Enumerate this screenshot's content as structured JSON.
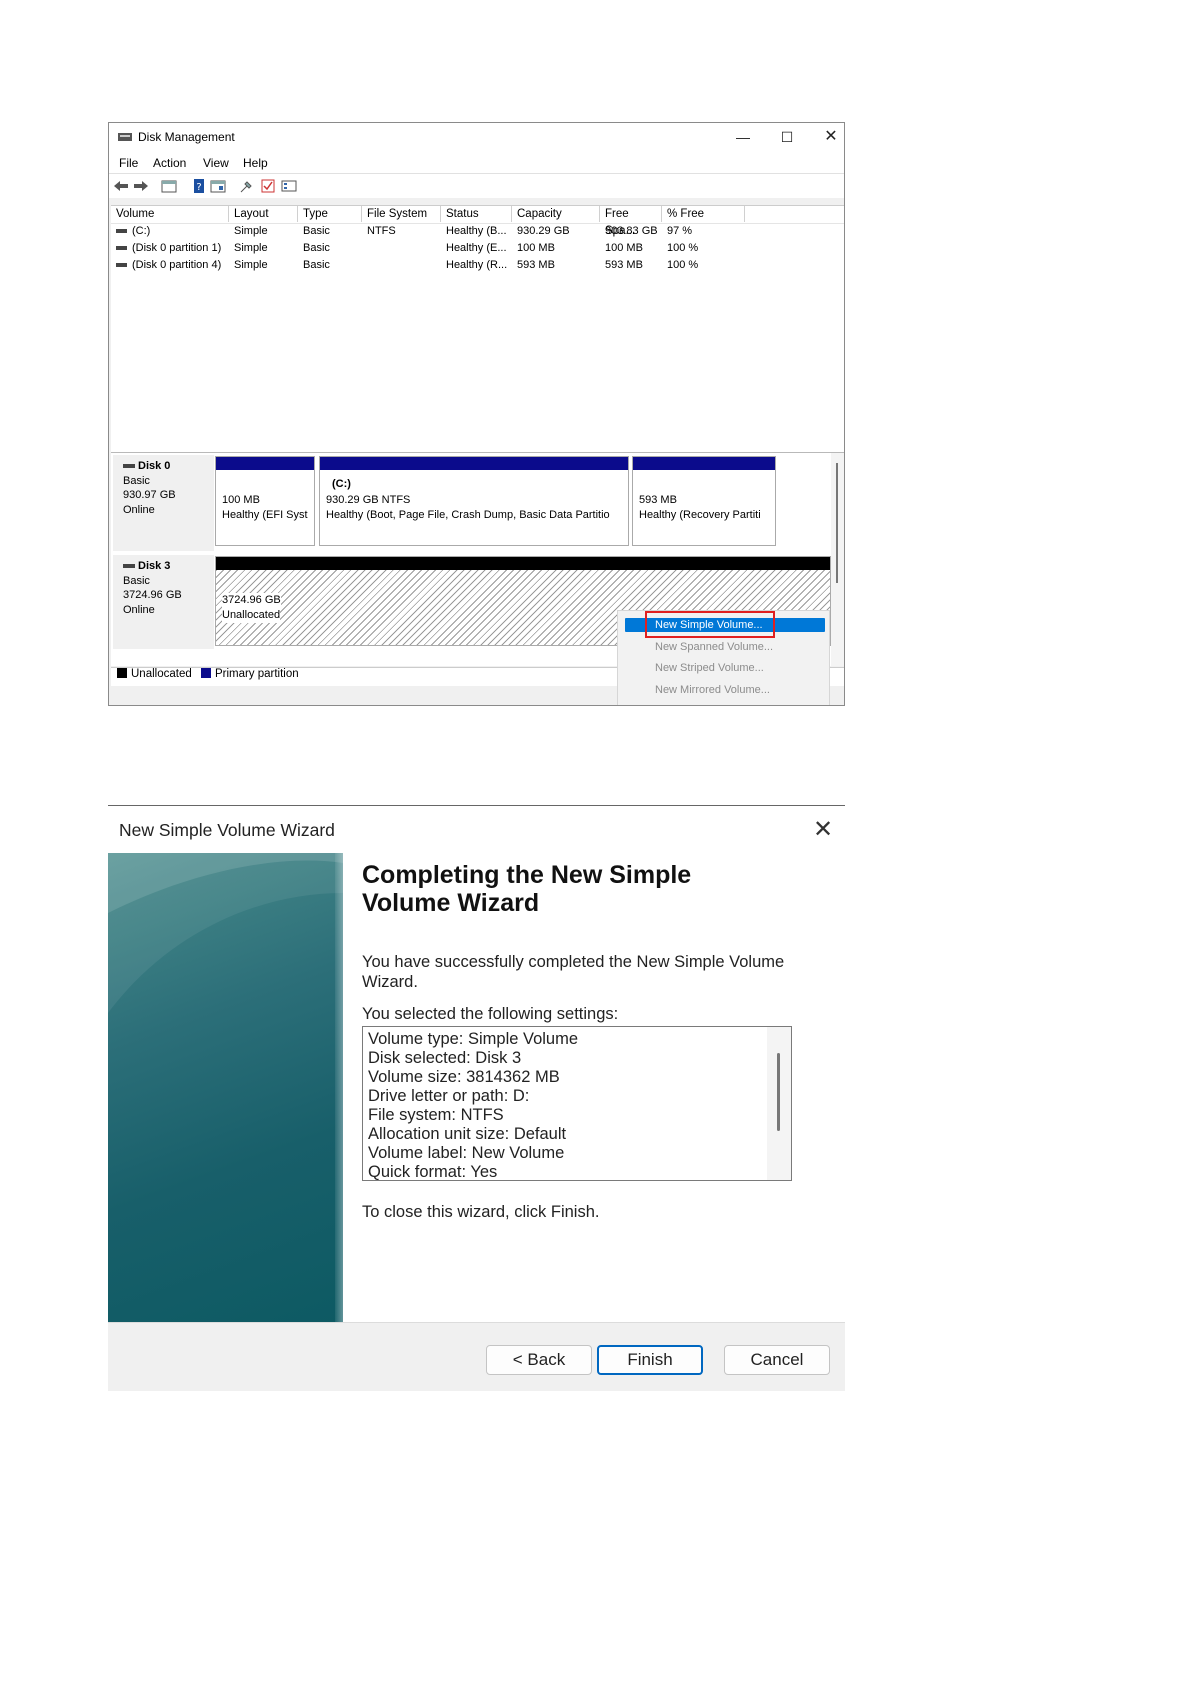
{
  "disk_mgmt": {
    "title": "Disk Management",
    "menu": [
      "File",
      "Action",
      "View",
      "Help"
    ],
    "columns": [
      "Volume",
      "Layout",
      "Type",
      "File System",
      "Status",
      "Capacity",
      "Free Spa...",
      "% Free"
    ],
    "rows": [
      [
        "(C:)",
        "Simple",
        "Basic",
        "NTFS",
        "Healthy (B...",
        "930.29 GB",
        "903.83 GB",
        "97 %"
      ],
      [
        "(Disk 0 partition 1)",
        "Simple",
        "Basic",
        "",
        "Healthy (E...",
        "100 MB",
        "100 MB",
        "100 %"
      ],
      [
        "(Disk 0 partition 4)",
        "Simple",
        "Basic",
        "",
        "Healthy (R...",
        "593 MB",
        "593 MB",
        "100 %"
      ]
    ],
    "disk0": {
      "name": "Disk 0",
      "type": "Basic",
      "size": "930.97 GB",
      "status": "Online",
      "partitions": [
        {
          "label": "",
          "line1": "100 MB",
          "line2": "Healthy (EFI Syst"
        },
        {
          "label": "(C:)",
          "line1": "930.29 GB NTFS",
          "line2": "Healthy (Boot, Page File, Crash Dump, Basic Data Partitio"
        },
        {
          "label": "",
          "line1": "593 MB",
          "line2": "Healthy (Recovery Partiti"
        }
      ]
    },
    "disk3": {
      "name": "Disk 3",
      "type": "Basic",
      "size": "3724.96 GB",
      "status": "Online",
      "partition": {
        "line1": "3724.96 GB",
        "line2": "Unallocated"
      }
    },
    "legend": [
      "Unallocated",
      "Primary partition"
    ],
    "context_menu": [
      "New Simple Volume...",
      "New Spanned Volume...",
      "New Striped Volume...",
      "New Mirrored Volume..."
    ],
    "colors": {
      "primary_partition": "#0b0b8c",
      "unallocated": "#000000",
      "selection": "#0078d7",
      "highlight_box": "#e02020"
    }
  },
  "wizard": {
    "title": "New Simple Volume Wizard",
    "heading_line1": "Completing the New Simple",
    "heading_line2": "Volume Wizard",
    "success_line1": "You have successfully completed the New Simple Volume",
    "success_line2": "Wizard.",
    "settings_label": "You selected the following settings:",
    "settings": [
      "Volume type: Simple Volume",
      "Disk selected: Disk 3",
      "Volume size: 3814362 MB",
      "Drive letter or path: D:",
      "File system: NTFS",
      "Allocation unit size: Default",
      "Volume label: New Volume",
      "Quick format: Yes"
    ],
    "close_hint": "To close this wizard, click Finish.",
    "buttons": {
      "back": "< Back",
      "finish": "Finish",
      "cancel": "Cancel"
    },
    "colors": {
      "side_panel": "#185f6a",
      "finish_border": "#0067c0"
    }
  }
}
